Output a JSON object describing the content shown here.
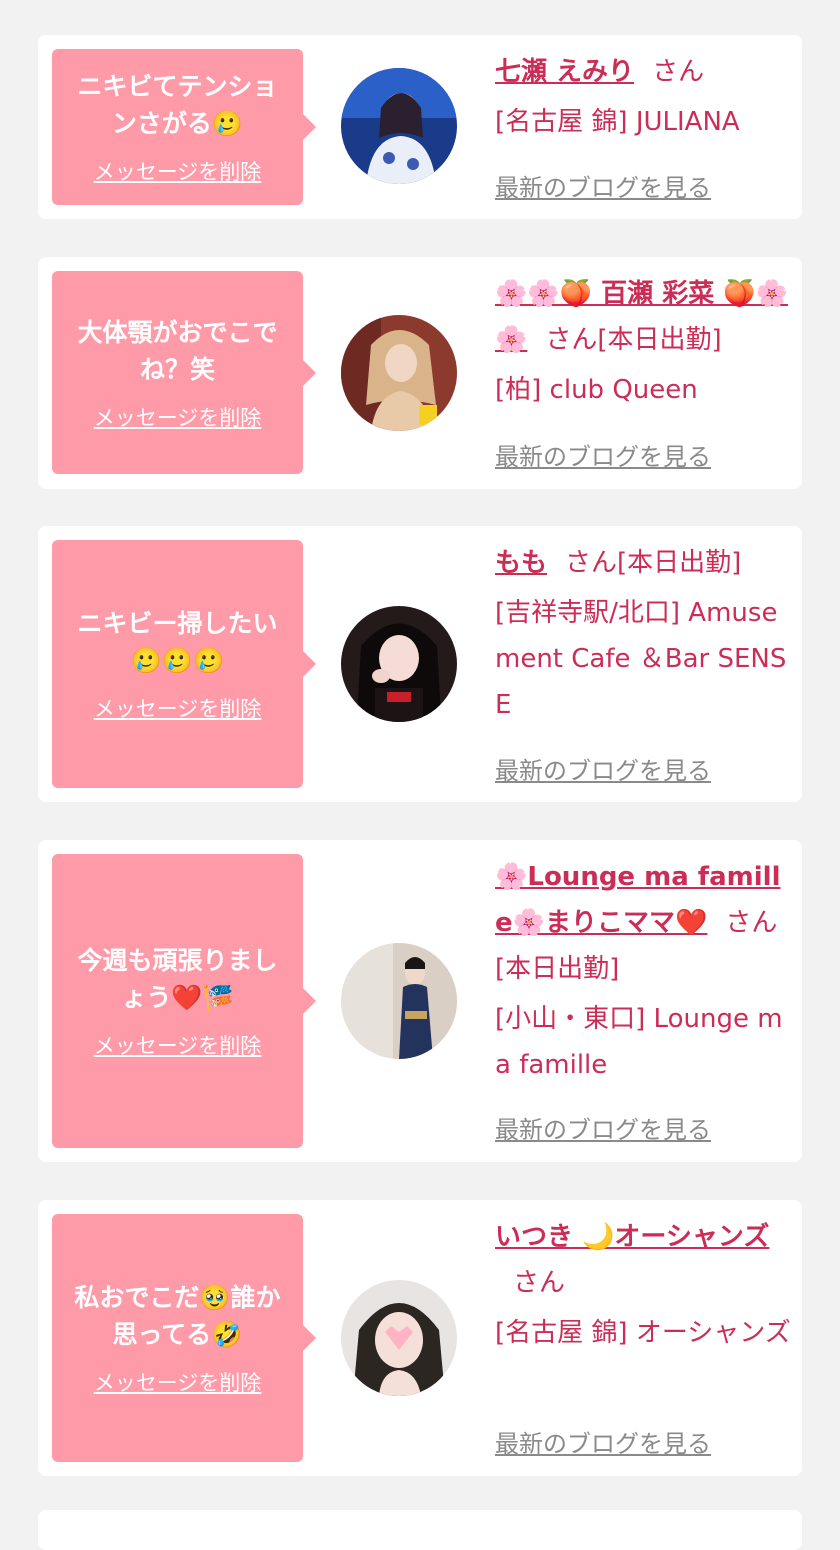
{
  "messages": [
    {
      "bubble_text": "ニキビてテンションさがる🥲",
      "delete_label": "メッセージを削除",
      "cast_name": "七瀬 えみり",
      "suffix": "さん",
      "shop": "[名古屋 錦] JULIANA",
      "blog_label": "最新のブログを見る",
      "avatar_colors": [
        "#1a3a8a",
        "#e9eef8"
      ]
    },
    {
      "bubble_text": "大体顎がおでこでね？笑",
      "delete_label": "メッセージを削除",
      "cast_name": "🌸🌸🍑 百瀬 彩菜 🍑🌸🌸",
      "suffix": "さん[本日出勤]",
      "shop": "[柏] club Queen",
      "blog_label": "最新のブログを見る",
      "avatar_colors": [
        "#8c3a2e",
        "#e8c9a8"
      ]
    },
    {
      "bubble_text": "ニキビー掃したい🥲🥲🥲",
      "delete_label": "メッセージを削除",
      "cast_name": "もも",
      "suffix": "さん[本日出勤]",
      "shop": "[吉祥寺駅/北口] Amusement Cafe ＆Bar SENSE",
      "blog_label": "最新のブログを見る",
      "avatar_colors": [
        "#241a1a",
        "#f2d4cf"
      ]
    },
    {
      "bubble_text": "今週も頑張りましょう❤️🎏",
      "delete_label": "メッセージを削除",
      "cast_name": "🌸Lounge ma famille🌸まりこママ❤️",
      "suffix": "さん[本日出勤]",
      "shop": "[小山・東口] Lounge ma famille",
      "blog_label": "最新のブログを見る",
      "avatar_colors": [
        "#23335e",
        "#e6e1da"
      ]
    },
    {
      "bubble_text": "私おでこだ🥹誰か思ってる🤣",
      "delete_label": "メッセージを削除",
      "cast_name": "いつき 🌙オーシャンズ",
      "suffix": "さん",
      "shop": "[名古屋 錦] オーシャンズ",
      "blog_label": "最新のブログを見る",
      "avatar_colors": [
        "#2b2622",
        "#ffd6dc"
      ]
    }
  ],
  "colors": {
    "accent": "#cc2d57",
    "bubble": "#ff9aa8",
    "background": "#f2f2f2",
    "card": "#ffffff",
    "link_gray": "#8a8a8a"
  }
}
